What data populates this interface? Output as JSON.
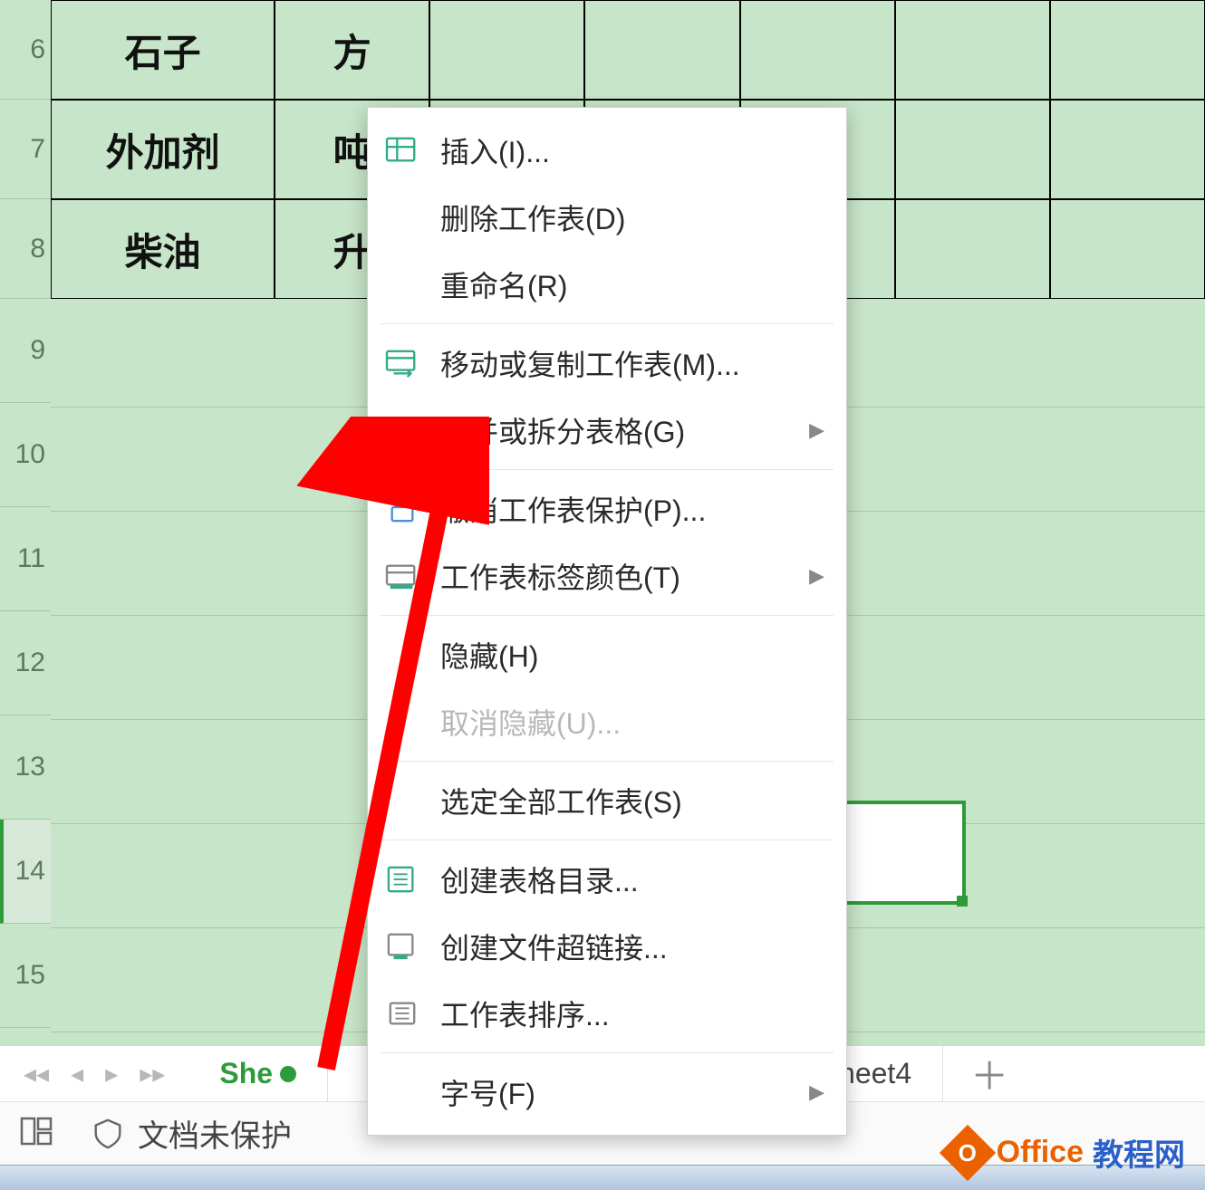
{
  "rows": {
    "r6": "6",
    "r7": "7",
    "r8": "8",
    "r9": "9",
    "r10": "10",
    "r11": "11",
    "r12": "12",
    "r13": "13",
    "r14": "14",
    "r15": "15"
  },
  "cells": {
    "a6": "石子",
    "b6": "方",
    "a7": "外加剂",
    "b7": "吨",
    "a8": "柴油",
    "b8": "升"
  },
  "menu": {
    "insert": "插入(I)...",
    "delete_sheet": "删除工作表(D)",
    "rename": "重命名(R)",
    "move_copy": "移动或复制工作表(M)...",
    "merge_split": "合并或拆分表格(G)",
    "unprotect": "撤消工作表保护(P)...",
    "tab_color": "工作表标签颜色(T)",
    "hide": "隐藏(H)",
    "unhide": "取消隐藏(U)...",
    "select_all": "选定全部工作表(S)",
    "create_toc": "创建表格目录...",
    "create_link": "创建文件超链接...",
    "sheet_sort": "工作表排序...",
    "font_size": "字号(F)"
  },
  "tabs": {
    "active_partial": "She",
    "right_partial": "heet4"
  },
  "status": {
    "doc_unprotected": "文档未保护"
  },
  "watermark": {
    "office": "Office",
    "suffix": "教程网"
  }
}
